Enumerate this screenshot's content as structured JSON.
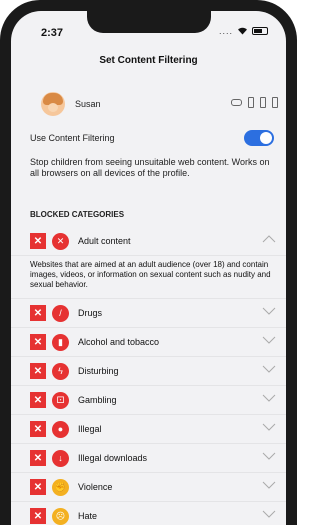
{
  "status": {
    "time": "2:37",
    "extra": "...."
  },
  "nav": {
    "title": "Set Content Filtering"
  },
  "profile": {
    "name": "Susan"
  },
  "filter": {
    "label": "Use Content Filtering",
    "enabled": true
  },
  "description": "Stop children from seeing unsuitable web content. Works on all browsers on all devices of the profile.",
  "section": {
    "header": "BLOCKED CATEGORIES"
  },
  "categories": [
    {
      "label": "Adult content",
      "icon": "adult-xxx-icon",
      "expanded": true,
      "details": "Websites that are aimed at an adult audience (over 18) and contain images, videos, or information on sexual content such as nudity and sexual behavior."
    },
    {
      "label": "Drugs",
      "icon": "syringe-icon"
    },
    {
      "label": "Alcohol and tobacco",
      "icon": "bottle-icon"
    },
    {
      "label": "Disturbing",
      "icon": "lightning-icon"
    },
    {
      "label": "Gambling",
      "icon": "dice-icon"
    },
    {
      "label": "Illegal",
      "icon": "thief-icon"
    },
    {
      "label": "Illegal downloads",
      "icon": "download-icon"
    },
    {
      "label": "Violence",
      "icon": "fist-icon",
      "color": "yellow"
    },
    {
      "label": "Hate",
      "icon": "angry-icon",
      "color": "yellow"
    }
  ],
  "colors": {
    "blocked": "#e63232",
    "toggle": "#2c6fe0",
    "warning": "#f3b021"
  }
}
